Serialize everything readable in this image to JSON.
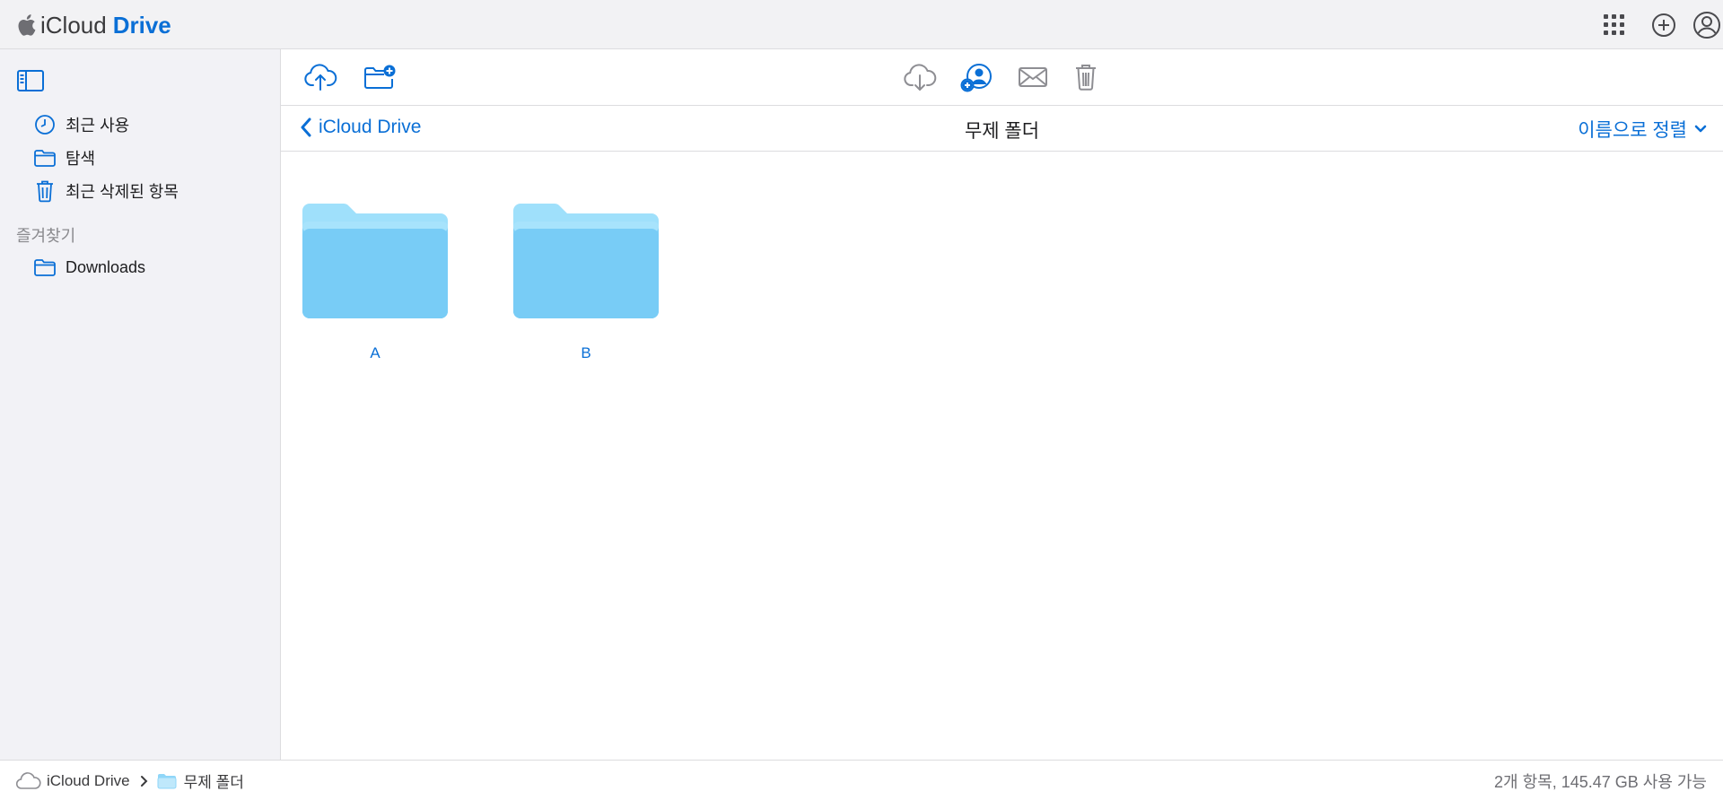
{
  "app": {
    "brand_prefix": "iCloud",
    "brand_name": "Drive"
  },
  "sidebar": {
    "items": [
      {
        "label": "최근 사용",
        "icon": "clock-icon"
      },
      {
        "label": "탐색",
        "icon": "folder-icon"
      },
      {
        "label": "최근 삭제된 항목",
        "icon": "trash-icon"
      }
    ],
    "favorites_title": "즐겨찾기",
    "favorites": [
      {
        "label": "Downloads",
        "icon": "folder-icon"
      }
    ]
  },
  "nav": {
    "back_label": "iCloud Drive",
    "folder_title": "무제 폴더",
    "sort_label": "이름으로 정렬"
  },
  "items": [
    {
      "name": "A"
    },
    {
      "name": "B"
    }
  ],
  "status": {
    "breadcrumb_root": "iCloud Drive",
    "breadcrumb_current": "무제 폴더",
    "summary": "2개 항목, 145.47 GB 사용 가능"
  },
  "colors": {
    "accent": "#0a6fd6",
    "folder_light": "#8fdcfc",
    "folder_dark": "#6fcaf5"
  }
}
